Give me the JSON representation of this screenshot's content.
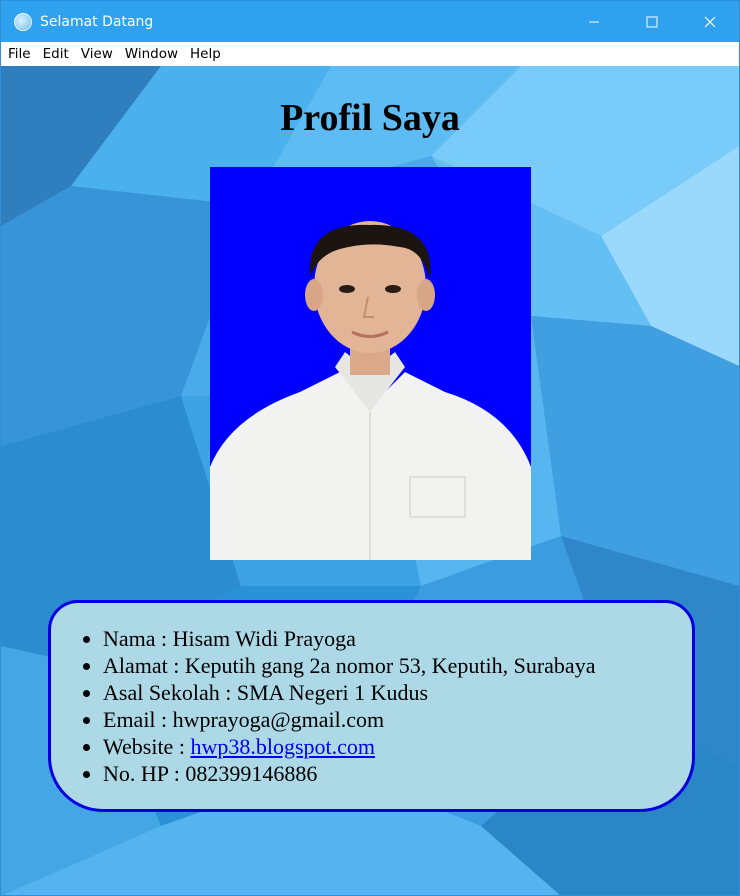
{
  "window": {
    "title": "Selamat Datang",
    "accent": "#2ea2ee"
  },
  "menu": {
    "items": [
      "File",
      "Edit",
      "View",
      "Window",
      "Help"
    ]
  },
  "page": {
    "title": "Profil Saya",
    "photo_background": "#0000fe"
  },
  "profile": {
    "nama_label": "Nama : ",
    "nama_value": "Hisam Widi Prayoga",
    "alamat_label": "Alamat : ",
    "alamat_value": "Keputih gang 2a nomor 53, Keputih, Surabaya",
    "sekolah_label": "Asal Sekolah : ",
    "sekolah_value": "SMA Negeri 1 Kudus",
    "email_label": "Email : ",
    "email_value": "hwprayoga@gmail.com",
    "website_label": "Website : ",
    "website_value": "hwp38.blogspot.com",
    "hp_label": "No. HP : ",
    "hp_value": "082399146886"
  },
  "colors": {
    "box_fill": "#add8e6",
    "box_border": "#0000e0",
    "link": "#0000ee"
  }
}
